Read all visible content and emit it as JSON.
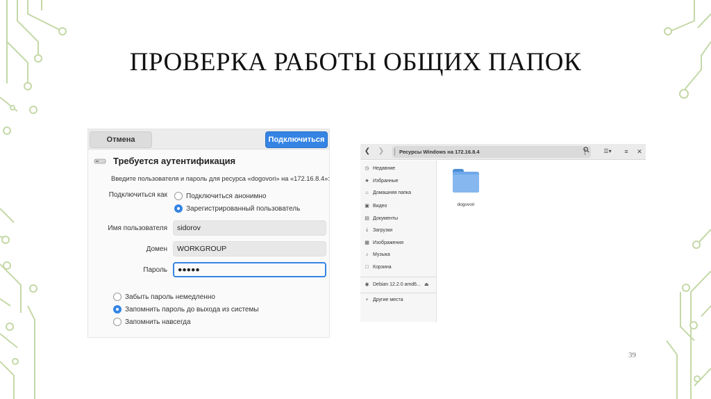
{
  "slide": {
    "title": "ПРОВЕРКА РАБОТЫ ОБЩИХ ПАПОК",
    "page_number": "39"
  },
  "auth_dialog": {
    "cancel_label": "Отмена",
    "connect_label": "Подключиться",
    "title": "Требуется аутентификация",
    "description": "Введите пользователя и пароль для ресурса «dogovori» на «172.16.8.4»:",
    "connect_as_label": "Подключиться как",
    "anonymous_label": "Подключиться анонимно",
    "registered_label": "Зарегистрированный пользователь",
    "username_label": "Имя пользователя",
    "username_value": "sidorov",
    "domain_label": "Домен",
    "domain_value": "WORKGROUP",
    "password_label": "Пароль",
    "password_value": "●●●●●",
    "forget_now_label": "Забыть пароль немедленно",
    "remember_session_label": "Запомнить пароль до выхода из системы",
    "remember_forever_label": "Запомнить навсегда",
    "colors": {
      "accent": "#3584e4"
    }
  },
  "file_manager": {
    "path": "Ресурсы Windows на 172.16.8.4",
    "sidebar": [
      {
        "icon": "clock-icon",
        "label": "Недавние"
      },
      {
        "icon": "star-icon",
        "label": "Избранные"
      },
      {
        "icon": "home-icon",
        "label": "Домашняя папка"
      },
      {
        "icon": "video-icon",
        "label": "Видео"
      },
      {
        "icon": "document-icon",
        "label": "Документы"
      },
      {
        "icon": "download-icon",
        "label": "Загрузки"
      },
      {
        "icon": "image-icon",
        "label": "Изображения"
      },
      {
        "icon": "music-icon",
        "label": "Музыка"
      },
      {
        "icon": "trash-icon",
        "label": "Корзина"
      },
      {
        "icon": "disc-icon",
        "label": "Debian 12.2.0 amd6..."
      },
      {
        "icon": "plus-icon",
        "label": "Другие места"
      }
    ],
    "folder_label": "dogovori"
  }
}
